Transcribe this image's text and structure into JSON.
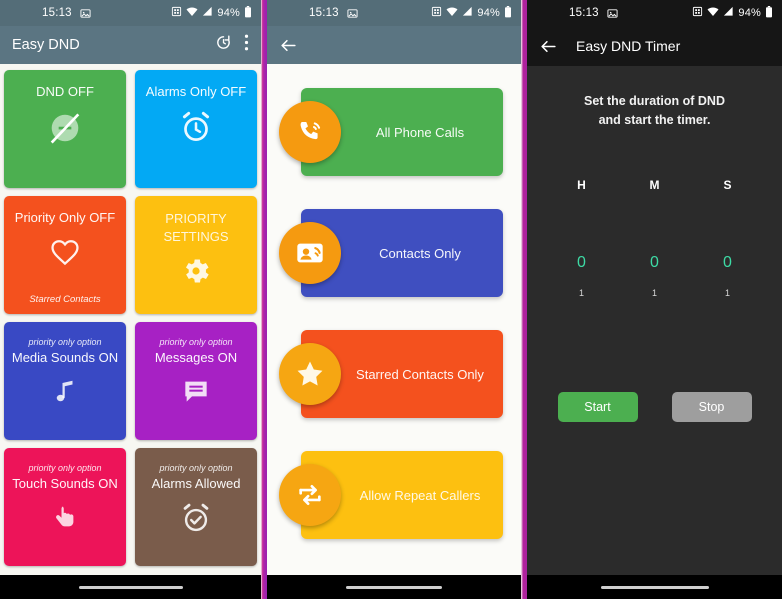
{
  "panels": {
    "main": {
      "statusbar": {
        "time": "15:13",
        "battery": "94%",
        "icons": [
          "image-icon",
          "wifi-icon",
          "signal-icon",
          "battery-icon"
        ]
      },
      "appbar": {
        "title": "Easy DND",
        "timer_icon": "timer-restore-icon",
        "overflow_icon": "overflow-menu-icon"
      },
      "tiles": [
        {
          "title": "DND OFF",
          "sub_top": "",
          "sub_bottom": "",
          "icon": "dnd-off-icon",
          "color": "#4caf50"
        },
        {
          "title": "Alarms Only OFF",
          "sub_top": "",
          "sub_bottom": "",
          "icon": "alarm-clock-icon",
          "color": "#03a9f4"
        },
        {
          "title": "Priority Only OFF",
          "sub_top": "",
          "sub_bottom": "Starred Contacts",
          "icon": "heart-icon",
          "color": "#f4511e"
        },
        {
          "title": "PRIORITY SETTINGS",
          "sub_top": "",
          "sub_bottom": "",
          "icon": "gear-icon",
          "color": "#fdc010"
        },
        {
          "title": "Media Sounds ON",
          "sub_top": "priority only option",
          "sub_bottom": "",
          "icon": "music-note-icon",
          "color": "#3949c4"
        },
        {
          "title": "Messages ON",
          "sub_top": "priority only option",
          "sub_bottom": "",
          "icon": "message-icon",
          "color": "#a721c4"
        },
        {
          "title": "Touch Sounds ON",
          "sub_top": "priority only option",
          "sub_bottom": "",
          "icon": "touch-icon",
          "color": "#ed1459"
        },
        {
          "title": "Alarms Allowed",
          "sub_top": "priority only option",
          "sub_bottom": "",
          "icon": "alarm-check-icon",
          "color": "#7a5c4b"
        }
      ]
    },
    "priority": {
      "statusbar": {
        "time": "15:13",
        "battery": "94%"
      },
      "appbar": {
        "back_icon": "back-arrow-icon",
        "title": ""
      },
      "cards": [
        {
          "label": "All Phone Calls",
          "icon": "phone-ring-icon",
          "color": "#4caf50"
        },
        {
          "label": "Contacts Only",
          "icon": "contact-card-icon",
          "color": "#3f4fc0"
        },
        {
          "label": "Starred Contacts Only",
          "icon": "star-icon",
          "color": "#f4511e"
        },
        {
          "label": "Allow Repeat Callers",
          "icon": "repeat-icon",
          "color": "#fdc010"
        }
      ]
    },
    "timer": {
      "statusbar": {
        "time": "15:13",
        "battery": "94%"
      },
      "appbar": {
        "back_icon": "back-arrow-icon",
        "title": "Easy DND Timer"
      },
      "instruction_line1": "Set the duration of DND",
      "instruction_line2": "and start the timer.",
      "picker": [
        {
          "head": "H",
          "value": "0",
          "next": "1"
        },
        {
          "head": "M",
          "value": "0",
          "next": "1"
        },
        {
          "head": "S",
          "value": "0",
          "next": "1"
        }
      ],
      "buttons": {
        "start": "Start",
        "stop": "Stop"
      }
    }
  },
  "colors": {
    "appbar": "#5b7582",
    "statusbar": "#546d78",
    "dark_bg": "#2b2b2b",
    "divider": "#b2239a",
    "accent_teal": "#3ddba5",
    "fab_orange": "#f59a10"
  }
}
